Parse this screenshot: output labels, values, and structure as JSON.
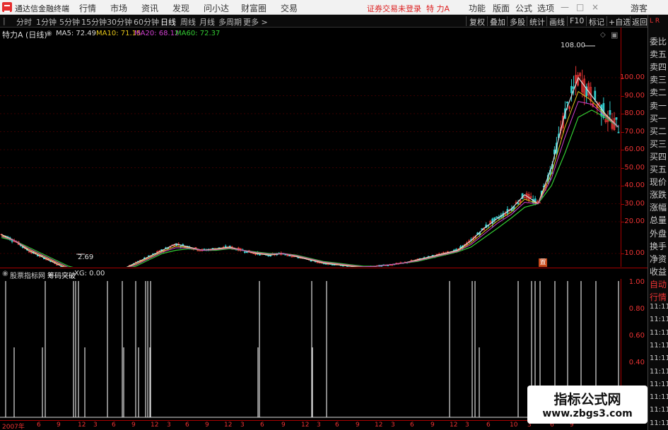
{
  "app": {
    "title": "通达信金融终端",
    "menu": [
      "行情",
      "市场",
      "资讯",
      "发现",
      "问小达",
      "财富圈",
      "交易"
    ],
    "status_text": "证券交易未登录",
    "stock_short": "特 力A",
    "right_menu": [
      "功能",
      "版面",
      "公式",
      "选项"
    ],
    "guest": "游客"
  },
  "toolbar": {
    "periods": [
      "分时",
      "1分钟",
      "5分钟",
      "15分钟",
      "30分钟",
      "60分钟",
      "日线",
      "周线",
      "月线",
      "多周期",
      "更多 >"
    ],
    "active_period": "日线",
    "tools": [
      "复权",
      "叠加",
      "多股",
      "统计",
      "画线",
      "F10",
      "标记",
      "+自选",
      "返回"
    ]
  },
  "main": {
    "stock_label": "特力A (日线)",
    "ma": [
      {
        "label": "MA5: 72.49",
        "color": "#dddddd"
      },
      {
        "label": "MA10: 71.15",
        "color": "#e6c619"
      },
      {
        "label": "MA20: 68.12",
        "color": "#d040d0"
      },
      {
        "label": "MA60: 72.37",
        "color": "#33cc33"
      }
    ],
    "high_label": "108.00",
    "low_label": "2.69",
    "marker_label": "置",
    "price_ticks": [
      "100.00",
      "90.00",
      "80.00",
      "70.00",
      "60.00",
      "50.00",
      "40.00",
      "30.00",
      "20.00",
      "10.00"
    ]
  },
  "sidebar": {
    "lr": "L R",
    "items": [
      "委比",
      "卖五",
      "卖四",
      "卖三",
      "卖二",
      "卖一",
      "买一",
      "买二",
      "买三",
      "买四",
      "买五",
      "现价",
      "涨跌",
      "涨幅",
      "总量",
      "外盘",
      "换手",
      "净资",
      "收益",
      "自动",
      "行情",
      "11:11",
      "11:11",
      "11:11",
      "11:11",
      "11:11",
      "11:11",
      "11:11",
      "11:11",
      "11:11",
      "11:11"
    ]
  },
  "indicator": {
    "title": "股票指标网",
    "name": "筹码突破",
    "value_label": "XG: 0.00",
    "axis_ticks": [
      "1.00",
      "0.80",
      "0.60",
      "0.40"
    ]
  },
  "date_axis": [
    "2007年",
    "6",
    "9",
    "12",
    "3",
    "6",
    "9",
    "12",
    "3",
    "6",
    "9",
    "12",
    "3",
    "6",
    "9",
    "12",
    "3",
    "6",
    "9",
    "12",
    "3",
    "6",
    "9",
    "12",
    "3",
    "6",
    "10",
    "3",
    "6",
    "9"
  ],
  "watermark": {
    "title": "指标公式网",
    "url": "www.zbgs3.com"
  },
  "colors": {
    "up": "#e33333",
    "down": "#33cccc",
    "axis": "#aa0000"
  },
  "chart_data": {
    "type": "line",
    "title": "",
    "ylim": [
      0,
      115
    ],
    "xlabel": "",
    "ylabel": "",
    "series": [
      {
        "name": "MA5",
        "values": [
          16,
          14,
          11,
          9,
          7,
          5,
          3.5,
          3,
          3.5,
          5,
          7,
          9,
          11,
          13,
          12,
          11,
          11.5,
          12,
          11,
          10,
          9.5,
          10,
          9,
          8,
          7,
          6.5,
          6,
          5.5,
          6,
          6.5,
          7,
          8,
          9,
          10,
          11,
          14,
          18,
          22,
          27,
          35,
          30,
          50,
          80,
          100,
          90,
          80,
          72.49
        ]
      },
      {
        "name": "MA60",
        "values": [
          15,
          14,
          12,
          10,
          8,
          6,
          5,
          4.5,
          4.5,
          5,
          6,
          8,
          10,
          11,
          11.5,
          11,
          11,
          11.5,
          11,
          10.5,
          10,
          10,
          9.5,
          8.5,
          7.5,
          7,
          6.5,
          6,
          6,
          6.5,
          7,
          7.5,
          8.5,
          9.5,
          10.5,
          12,
          15,
          18,
          22,
          28,
          30,
          40,
          58,
          78,
          82,
          78,
          72.37
        ]
      }
    ],
    "xg_signal_count": 35
  }
}
